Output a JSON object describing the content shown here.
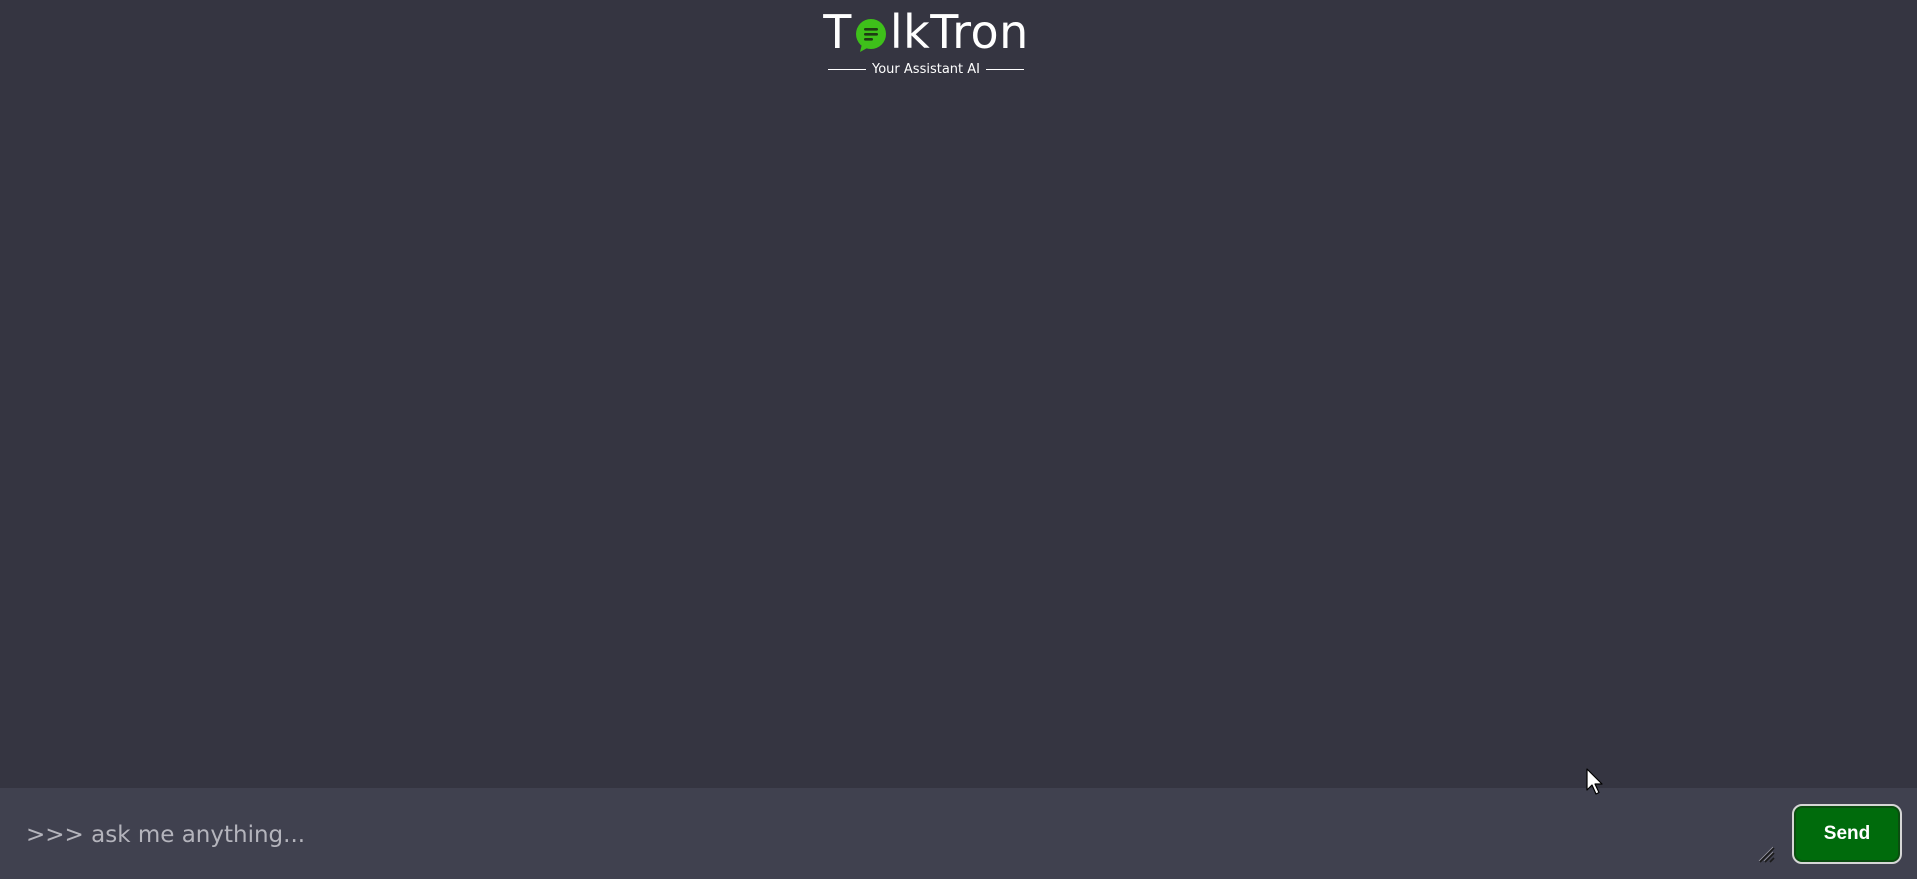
{
  "header": {
    "logo_prefix": "T",
    "logo_suffix": "lkTron",
    "tagline": "Your Assistant AI",
    "logo_icon": "chat-bubble-icon"
  },
  "input": {
    "placeholder": ">>> ask me anything...",
    "value": ""
  },
  "send": {
    "label": "Send"
  },
  "colors": {
    "background": "#353541",
    "input_bar": "#40414f",
    "send_button": "#006b0c",
    "logo_bubble": "#3ec01a"
  }
}
